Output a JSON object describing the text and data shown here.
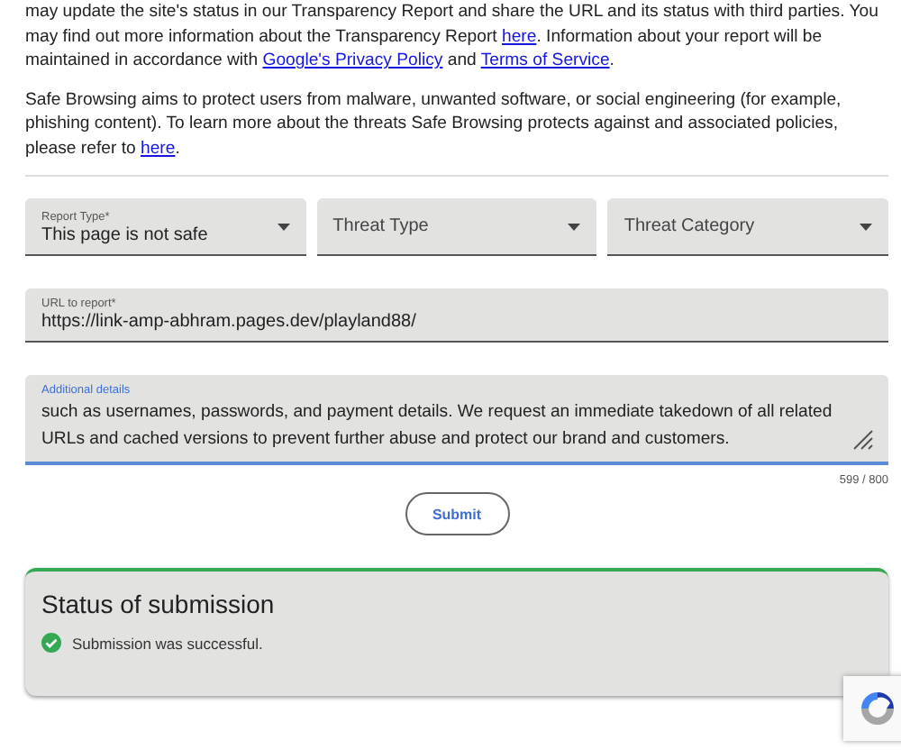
{
  "intro_paragraphs": [
    [
      {
        "kind": "text",
        "text": "may update the site's status in our Transparency Report and share the URL and its status with third parties. You may find out more information about the Transparency Report "
      },
      {
        "kind": "link",
        "text": "here"
      },
      {
        "kind": "text",
        "text": ". Information about your report will be maintained in accordance with "
      },
      {
        "kind": "link",
        "text": "Google's Privacy Policy"
      },
      {
        "kind": "text",
        "text": " and "
      },
      {
        "kind": "link",
        "text": "Terms of Service"
      },
      {
        "kind": "text",
        "text": "."
      }
    ],
    [
      {
        "kind": "text",
        "text": "Safe Browsing aims to protect users from malware, unwanted software, or social engineering (for example, phishing content). To learn more about the threats Safe Browsing protects against and associated policies, please refer to "
      },
      {
        "kind": "link",
        "text": "here"
      },
      {
        "kind": "text",
        "text": "."
      }
    ]
  ],
  "dropdowns": [
    {
      "label": "Report Type*",
      "value": "This page is not safe"
    },
    {
      "placeholder": "Threat Type"
    },
    {
      "placeholder": "Threat Category"
    }
  ],
  "url_field": {
    "label": "URL to report*",
    "value": "https://link-amp-abhram.pages.dev/playland88/"
  },
  "details_field": {
    "label": "Additional details",
    "value": "such as usernames, passwords, and payment details. We request an immediate takedown of all related URLs and cached versions to prevent further abuse and protect our brand and customers.",
    "focused": true,
    "counter": "599 / 800"
  },
  "submit_button": "Submit",
  "status": {
    "title": "Status of submission",
    "message": "Submission was successful.",
    "success": true
  }
}
